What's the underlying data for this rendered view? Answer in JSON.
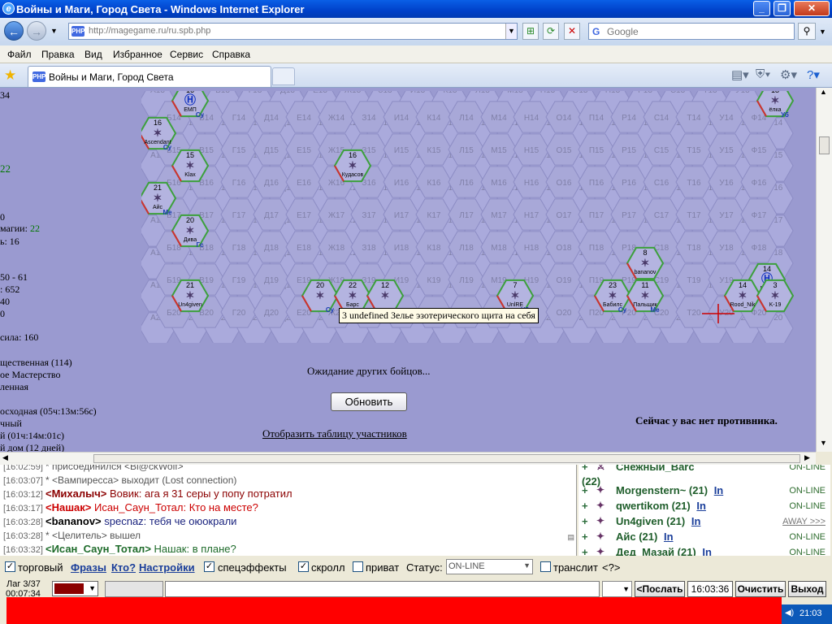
{
  "window": {
    "title": "Войны и Маги, Город Света - Windows Internet Explorer"
  },
  "address": {
    "url_host": "http://magegame.ru",
    "url_path": "/ru.spb.php",
    "fav": "PHP"
  },
  "search": {
    "placeholder": "Google"
  },
  "menu": [
    "Файл",
    "Правка",
    "Вид",
    "Избранное",
    "Сервис",
    "Справка"
  ],
  "tab": {
    "title": "Войны и Маги, Город Света",
    "fav": "PHP"
  },
  "left_lines": [
    "34",
    "22",
    "0",
    "магии: 22",
    "ь: 16",
    "50 - 61",
    ": 652",
    "40",
    "0",
    "сила: 160",
    "щественная (114)",
    "ое Мастерство",
    "ленная",
    "осходная (05ч:13м:56с)",
    "чный",
    "й (01ч:14м:01с)",
    "й дом (12 дней)"
  ],
  "board": {
    "rows": [
      [
        "А13",
        "Б13",
        "В13",
        "Г13",
        "Д13",
        "Е13",
        "Ж13",
        "З13",
        "И13",
        "К13",
        "Л13",
        "М13",
        "Н13",
        "О13",
        "П13",
        "Р13",
        "С13",
        "Т13",
        "У13",
        "Ф13"
      ],
      [
        "А14",
        "Б14",
        "В14",
        "Г14",
        "Д14",
        "Е14",
        "Ж14",
        "З14",
        "И14",
        "К14",
        "Л14",
        "М14",
        "Н14",
        "О14",
        "П14",
        "Р14",
        "С14",
        "Т14",
        "У14",
        "Ф14"
      ],
      [
        "А15",
        "Б15",
        "В15",
        "Г15",
        "Д15",
        "Е15",
        "Ж15",
        "З15",
        "И15",
        "К15",
        "Л15",
        "М15",
        "Н15",
        "О15",
        "П15",
        "Р15",
        "С15",
        "Т15",
        "У15",
        "Ф15"
      ],
      [
        "А16",
        "Б16",
        "В16",
        "Г16",
        "Д16",
        "Е16",
        "Ж16",
        "З16",
        "И16",
        "К16",
        "Л16",
        "М16",
        "Н16",
        "О16",
        "П16",
        "Р16",
        "С16",
        "Т16",
        "У16",
        "Ф16"
      ],
      [
        "А17",
        "Б17",
        "В17",
        "Г17",
        "Д17",
        "Е17",
        "Ж17",
        "З17",
        "И17",
        "К17",
        "Л17",
        "М17",
        "Н17",
        "О17",
        "П17",
        "Р17",
        "С17",
        "Т17",
        "У17",
        "Ф17"
      ],
      [
        "А18",
        "Б18",
        "В18",
        "Г18",
        "Д18",
        "Е18",
        "Ж18",
        "З18",
        "И18",
        "К18",
        "Л18",
        "М18",
        "Н18",
        "О18",
        "П18",
        "Р18",
        "С18",
        "Т18",
        "У18",
        "Ф18"
      ],
      [
        "А19",
        "Б19",
        "В19",
        "Г19",
        "Д19",
        "Е19",
        "Ж19",
        "З19",
        "И19",
        "К19",
        "Л19",
        "М19",
        "Н19",
        "О19",
        "П19",
        "Р19",
        "С19",
        "Т19",
        "У19",
        "Ф19"
      ],
      [
        "А20",
        "Б20",
        "В20",
        "Г20",
        "Д20",
        "Е20",
        "Ж20",
        "З20",
        "И20",
        "К20",
        "Л20",
        "М20",
        "Н20",
        "О20",
        "П20",
        "Р20",
        "С20",
        "Т20",
        "У20",
        "Ф20"
      ]
    ],
    "units": [
      {
        "lvl": "16",
        "name": "ЕМП",
        "tag": "Су",
        "r": 0,
        "c": 1,
        "k": "h"
      },
      {
        "lvl": "18",
        "name": "ёлка",
        "tag": "Уб",
        "r": 0,
        "c": 19,
        "k": "s"
      },
      {
        "lvl": "16",
        "name": "Ascendant",
        "tag": "Су",
        "r": 1,
        "c": 0,
        "k": "s"
      },
      {
        "lvl": "15",
        "name": "Klax",
        "tag": "",
        "r": 2,
        "c": 1,
        "k": "s"
      },
      {
        "lvl": "16",
        "name": "Кудасов",
        "tag": "",
        "r": 2,
        "c": 6,
        "k": "s"
      },
      {
        "lvl": "21",
        "name": "Айс",
        "tag": "Ме",
        "r": 3,
        "c": 0,
        "k": "s"
      },
      {
        "lvl": "20",
        "name": "Дива",
        "tag": "Гс",
        "r": 4,
        "c": 1,
        "k": "s"
      },
      {
        "lvl": "8",
        "name": "bananov",
        "tag": "",
        "r": 5,
        "c": 15,
        "k": "s"
      },
      {
        "lvl": "14",
        "name": "Maxx",
        "tag": "",
        "r": 5,
        "c": 38,
        "k": "h"
      },
      {
        "lvl": "21",
        "name": "Un4given",
        "tag": "",
        "r": 6,
        "c": 1,
        "k": "s"
      },
      {
        "lvl": "20",
        "name": "",
        "tag": "Су",
        "r": 6,
        "c": 5,
        "k": "s"
      },
      {
        "lvl": "22",
        "name": "Барс",
        "tag": "",
        "r": 6,
        "c": 6,
        "k": "s"
      },
      {
        "lvl": "12",
        "name": "",
        "tag": "",
        "r": 6,
        "c": 7,
        "k": "s"
      },
      {
        "lvl": "7",
        "name": "UnlRE",
        "tag": "Уб",
        "r": 6,
        "c": 11,
        "k": "s"
      },
      {
        "lvl": "23",
        "name": "Бабилс",
        "tag": "Су",
        "r": 6,
        "c": 14,
        "k": "s"
      },
      {
        "lvl": "11",
        "name": "Пальщик",
        "tag": "Ме",
        "r": 6,
        "c": 15,
        "k": "s"
      },
      {
        "lvl": "14",
        "name": "Rood_Nik",
        "tag": "",
        "r": 6,
        "c": 18,
        "k": "s"
      },
      {
        "lvl": "3",
        "name": "K-19",
        "tag": "",
        "r": 6,
        "c": 19,
        "k": "s"
      }
    ],
    "tooltip": "3 undefined Зелье эзотерического щита на себя"
  },
  "main": {
    "waiting": "Ожидание других бойцов...",
    "refresh": "Обновить",
    "show_table": "Отобразить таблицу участников",
    "no_opponent": "Сейчас у вас нет противника."
  },
  "chat": [
    {
      "time": "[16:02:59]",
      "text": "* присоединился <Bl@ckWolf>",
      "color": "#555"
    },
    {
      "time": "[16:03:07]",
      "text": "* <Вампиресса> выходит (Lost connection)",
      "color": "#555"
    },
    {
      "time": "[16:03:12]",
      "nick": "<Михалыч>",
      "text": " Вовик: ага я 31 серы у попу потратил",
      "nickcolor": "#8b0000",
      "color": "#8b0000"
    },
    {
      "time": "[16:03:17]",
      "nick": "<Нашак>",
      "text": " Исан_Саун_Тотал: Кто на месте?",
      "nickcolor": "#c00",
      "color": "#c00"
    },
    {
      "time": "[16:03:28]",
      "nick": "<bananov>",
      "text": " specnaz: тебя че оюокрали",
      "nickcolor": "#000",
      "color": "#1a237e"
    },
    {
      "time": "[16:03:28]",
      "text": "* <Целитель> вышел",
      "color": "#555"
    },
    {
      "time": "[16:03:32]",
      "nick": "<Исан_Саун_Тотал>",
      "text": " Нашак: в плане?",
      "nickcolor": "#1e6b2a",
      "color": "#1e6b2a"
    }
  ],
  "users": [
    {
      "name": "Снежный_Barс",
      "lvl": "(22)",
      "st": "ON-LINE"
    },
    {
      "name": "Morgenstern~ (21)",
      "lvl": "In",
      "st": "ON-LINE"
    },
    {
      "name": "qwertikom (21)",
      "lvl": "In",
      "st": "ON-LINE"
    },
    {
      "name": "Un4given (21)",
      "lvl": "In",
      "st": "AWAY >>>"
    },
    {
      "name": "Айс (21)",
      "lvl": "In",
      "st": "ON-LINE"
    },
    {
      "name": "Дед_Мазай (21)",
      "lvl": "In",
      "st": "ON-LINE"
    }
  ],
  "controls": {
    "trade": "торговый",
    "phrases": "Фразы",
    "who": "Кто?",
    "settings": "Настройки",
    "effects": "спецэффекты",
    "scroll": "скролл",
    "private": "приват",
    "status_label": "Статус:",
    "status_val": "ON-LINE",
    "translit": "транслит",
    "translit_q": "<?>"
  },
  "bottom": {
    "lag": "Лаг 3/37",
    "time_elapsed": "00:07:34",
    "send": "<Послать",
    "clock": "16:03:36",
    "clear": "Очистить",
    "exit": "Выход",
    "tray_time": "21:03"
  }
}
